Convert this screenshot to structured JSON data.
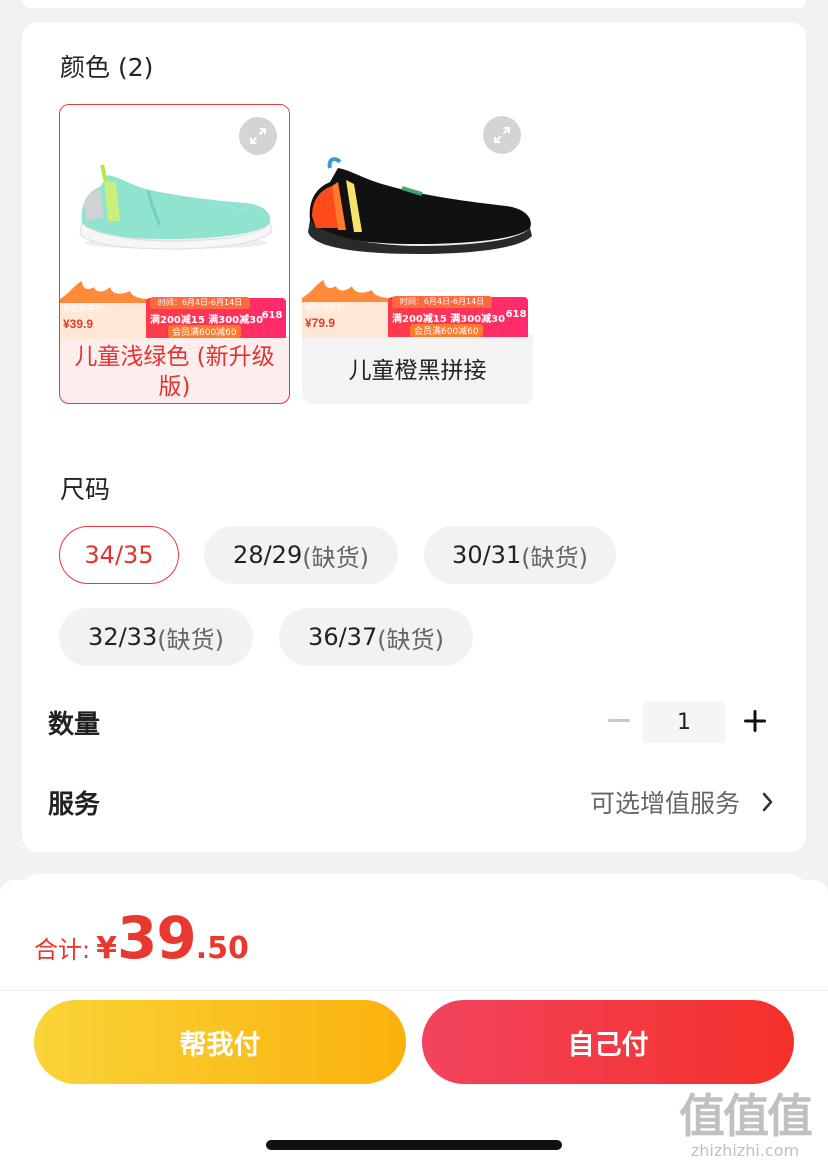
{
  "color_section": {
    "title": "颜色 (2)",
    "options": [
      {
        "label": "儿童浅绿色 (新升级版)",
        "selected": true,
        "promo": {
          "flame_caption": "预估到手价",
          "flame_price": "¥39.9",
          "date": "时间：6月4日-6月14日",
          "line1": "满200减15 满300减30",
          "line2": "会员满600减60",
          "badge": "618"
        }
      },
      {
        "label": "儿童橙黑拼接",
        "selected": false,
        "promo": {
          "flame_caption": "预估到手价",
          "flame_price": "¥79.9",
          "date": "时间：6月4日-6月14日",
          "line1": "满200减15 满300减30",
          "line2": "会员满600减60",
          "badge": "618"
        }
      }
    ]
  },
  "size_section": {
    "title": "尺码",
    "sizes": [
      {
        "size": "34/35",
        "note": "",
        "selected": true
      },
      {
        "size": "28/29",
        "note": "(缺货)",
        "selected": false
      },
      {
        "size": "30/31",
        "note": "(缺货)",
        "selected": false
      },
      {
        "size": "32/33",
        "note": "(缺货)",
        "selected": false
      },
      {
        "size": "36/37",
        "note": "(缺货)",
        "selected": false
      }
    ]
  },
  "quantity": {
    "label": "数量",
    "value": "1"
  },
  "service": {
    "label": "服务",
    "value": "可选增值服务"
  },
  "footer": {
    "total_label": "合计:",
    "currency": "¥",
    "price_int": "39",
    "price_dec": ".50",
    "help_pay": "帮我付",
    "self_pay": "自己付"
  },
  "watermark": {
    "big": "值值值",
    "small": "zhizhizhi.com"
  },
  "colors": {
    "accent_red": "#e8383a",
    "price_red": "#e8382f",
    "help_yellow": "#fbc21f",
    "self_red": "#f3364a"
  }
}
